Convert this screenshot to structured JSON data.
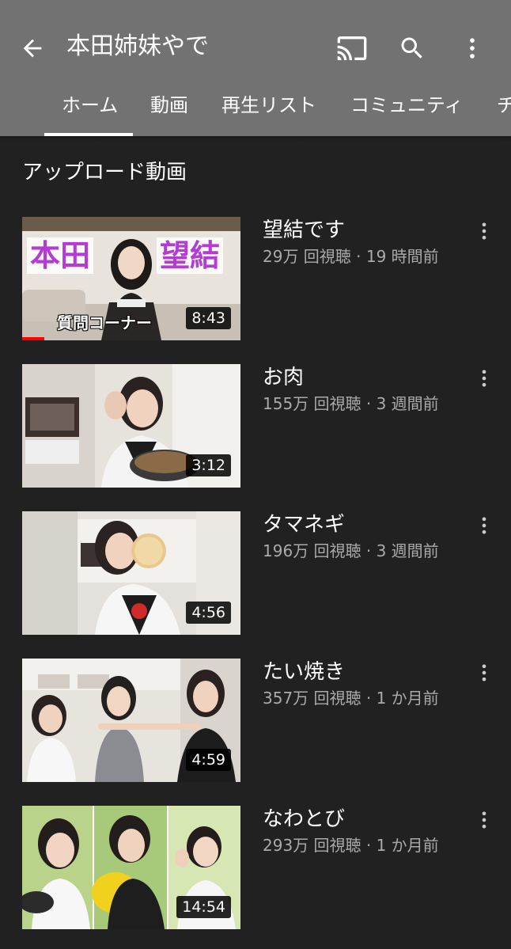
{
  "header": {
    "title": "本田姉妹やで",
    "background": "#727272",
    "icons": {
      "back": "arrow-back-icon",
      "cast": "cast-icon",
      "search": "search-icon",
      "more": "more-vert-icon"
    }
  },
  "tabs": [
    {
      "label": "ホーム",
      "active": true
    },
    {
      "label": "動画"
    },
    {
      "label": "再生リスト"
    },
    {
      "label": "コミュニティ"
    },
    {
      "label": "チ"
    }
  ],
  "section": {
    "title": "アップロード動画"
  },
  "videos": [
    {
      "title": "望結です",
      "meta": "29万 回視聴 · 19 時間前",
      "duration": "8:43",
      "watch_progress": 0.1,
      "thumbnail_text": [
        "本田",
        "望結",
        "質問コーナー"
      ]
    },
    {
      "title": "お肉",
      "meta": "155万 回視聴 · 3 週間前",
      "duration": "3:12"
    },
    {
      "title": "タマネギ",
      "meta": "196万 回視聴 · 3 週間前",
      "duration": "4:56"
    },
    {
      "title": "たい焼き",
      "meta": "357万 回視聴 · 1 か月前",
      "duration": "4:59"
    },
    {
      "title": "なわとび",
      "meta": "293万 回視聴 · 1 か月前",
      "duration": "14:54"
    }
  ]
}
